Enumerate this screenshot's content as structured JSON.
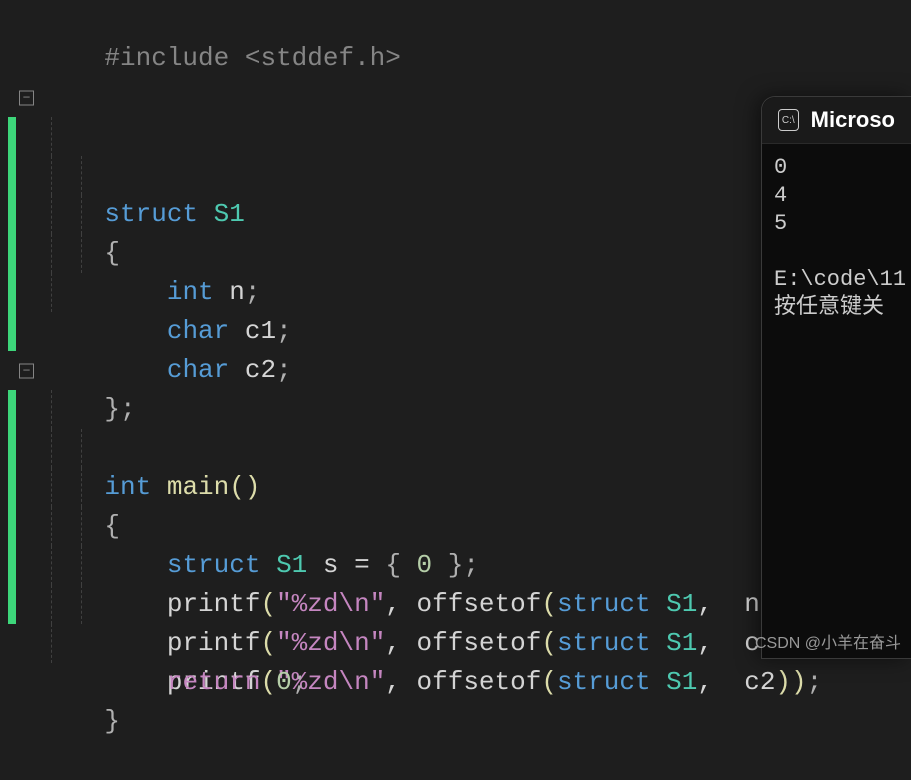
{
  "code": {
    "line1_preproc": "#include ",
    "line1_header": "<stddef.h>",
    "struct_kw": "struct",
    "struct_name": "S1",
    "brace_open": "{",
    "brace_close": "}",
    "brace_close_semi": ";",
    "int_kw": "int",
    "char_kw": "char",
    "field_n": " n",
    "field_c1": " c1",
    "field_c2": " c2",
    "semi": ";",
    "main_name": "main",
    "paren_open": "(",
    "paren_close": ")",
    "var_s": " s ",
    "equals": "= ",
    "brace_init_open": "{ ",
    "zero": "0",
    "brace_init_close": " }",
    "printf": "printf",
    "fmt_str": "\"%zd\\n\"",
    "comma": ", ",
    "offsetof": "offsetof",
    "arg_struct_s1": " S1",
    "arg_n": " n",
    "arg_c1": " c1",
    "arg_c2": " c2",
    "return_kw": "return",
    "return_val": " 0"
  },
  "console": {
    "title": "Microso",
    "out1": "0",
    "out2": "4",
    "out3": "5",
    "path": "E:\\code\\11",
    "prompt": "按任意键关"
  },
  "watermark": "CSDN @小羊在奋斗"
}
